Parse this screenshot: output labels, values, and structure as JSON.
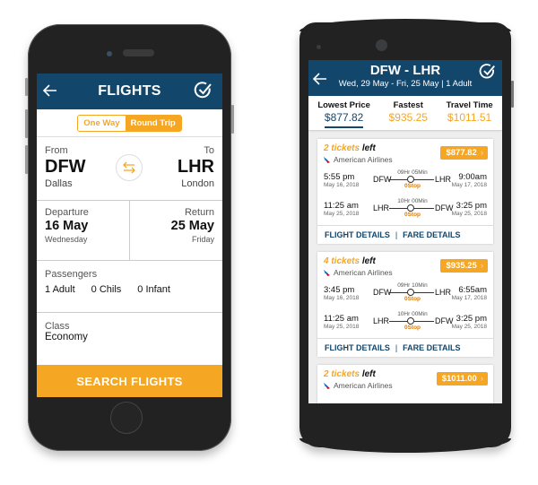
{
  "left_phone": {
    "header": {
      "title": "FLIGHTS",
      "back_icon": "arrow-left-icon",
      "confirm_icon": "check-circle-icon"
    },
    "trip_type": {
      "options": [
        "One Way",
        "Round Trip"
      ],
      "selected": "Round Trip"
    },
    "route": {
      "from_label": "From",
      "from_code": "DFW",
      "from_city": "Dallas",
      "to_label": "To",
      "to_code": "LHR",
      "to_city": "London",
      "swap_icon": "swap-arrows-icon"
    },
    "dates": {
      "departure_label": "Departure",
      "departure_date": "16 May",
      "departure_day": "Wednesday",
      "return_label": "Return",
      "return_date": "25 May",
      "return_day": "Friday"
    },
    "passengers": {
      "label": "Passengers",
      "adults": "1 Adult",
      "children": "0 Chils",
      "infants": "0 Infant"
    },
    "class": {
      "label": "Class",
      "value": "Economy"
    },
    "search_button": "SEARCH FLIGHTS"
  },
  "right_phone": {
    "header": {
      "title": "DFW - LHR",
      "subtitle": "Wed, 29 May - Fri, 25 May  |  1 Adult",
      "back_icon": "arrow-left-icon",
      "confirm_icon": "check-circle-icon"
    },
    "sort_tabs": [
      {
        "label": "Lowest Price",
        "price": "$877.82",
        "active": true
      },
      {
        "label": "Fastest",
        "price": "$935.25",
        "active": false
      },
      {
        "label": "Travel Time",
        "price": "$1011.51",
        "active": false
      }
    ],
    "results": [
      {
        "tickets_count": "2 tickets",
        "tickets_suffix": "left",
        "airline": "American Airlines",
        "price": "$877.82",
        "outbound": {
          "dep_time": "5:55 pm",
          "dep_date": "May 16, 2018",
          "from": "DFW",
          "duration": "09Hr 05Min",
          "stops": "0Stop",
          "to": "LHR",
          "arr_time": "9:00am",
          "arr_date": "May 17, 2018"
        },
        "inbound": {
          "dep_time": "11:25 am",
          "dep_date": "May 25, 2018",
          "from": "LHR",
          "duration": "10Hr 00Min",
          "stops": "0Stop",
          "to": "DFW",
          "arr_time": "3:25 pm",
          "arr_date": "May 25, 2018"
        },
        "links": [
          "FLIGHT DETAILS",
          "FARE DETAILS"
        ]
      },
      {
        "tickets_count": "4 tickets",
        "tickets_suffix": "left",
        "airline": "American Airlines",
        "price": "$935.25",
        "outbound": {
          "dep_time": "3:45 pm",
          "dep_date": "May 16, 2018",
          "from": "DFW",
          "duration": "09Hr 10Min",
          "stops": "0Stop",
          "to": "LHR",
          "arr_time": "6:55am",
          "arr_date": "May 17, 2018"
        },
        "inbound": {
          "dep_time": "11:25 am",
          "dep_date": "May 25, 2018",
          "from": "LHR",
          "duration": "10Hr 00Min",
          "stops": "0Stop",
          "to": "DFW",
          "arr_time": "3:25 pm",
          "arr_date": "May 25, 2018"
        },
        "links": [
          "FLIGHT DETAILS",
          "FARE DETAILS"
        ]
      },
      {
        "tickets_count": "2 tickets",
        "tickets_suffix": "left",
        "airline": "American Airlines",
        "price": "$1011.00"
      }
    ]
  },
  "colors": {
    "primary": "#13466b",
    "accent": "#f5a623",
    "stop": "#e07b00"
  }
}
